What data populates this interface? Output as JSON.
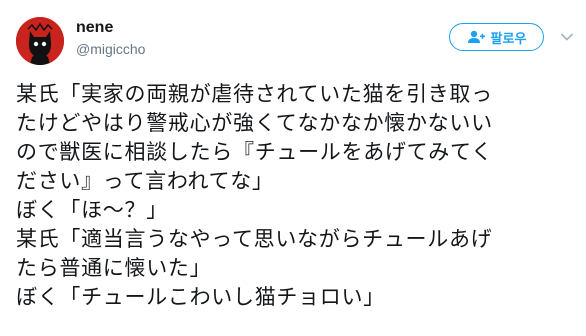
{
  "user": {
    "display_name": "nene",
    "screen_name": "@migiccho",
    "avatar_icon": "black-cat-avatar-icon"
  },
  "follow": {
    "label": "팔로우",
    "icon": "add-user-icon"
  },
  "menu": {
    "icon": "chevron-down-icon"
  },
  "tweet": {
    "lines": [
      "某氏「実家の両親が虐待されていた猫を引き取っ",
      "たけどやはり警戒心が強くてなかなか懐かないい",
      "ので獣医に相談したら『チュールをあげてみてく",
      "ださい』って言われてな」",
      "ぼく「ほ〜？」",
      "某氏「適当言うなやって思いながらチュールあげ",
      "たら普通に懐いた」",
      "ぼく「チュールこわいし猫チョロい」"
    ]
  },
  "colors": {
    "accent": "#1da1f2",
    "text": "#14171a",
    "secondary_text": "#657786",
    "avatar_bg": "#c8231c"
  }
}
